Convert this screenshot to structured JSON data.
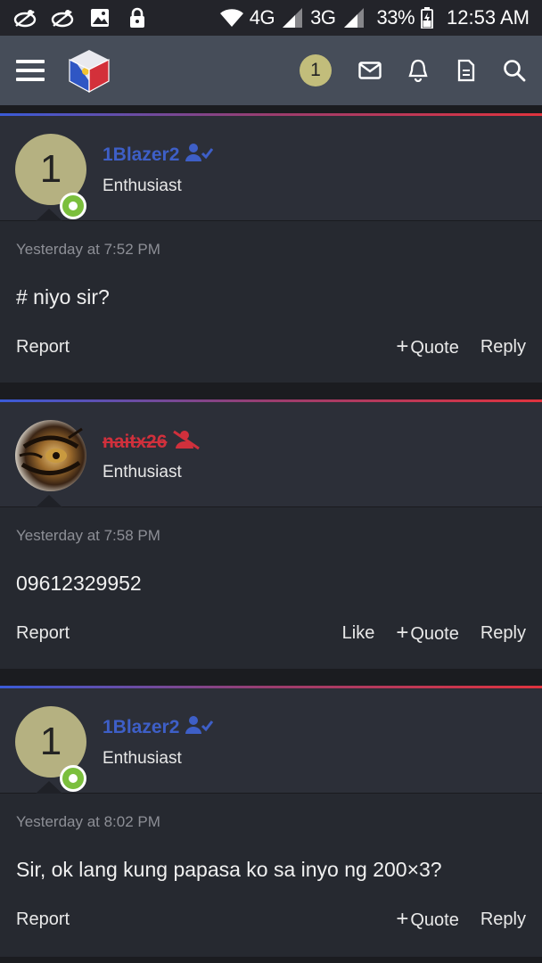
{
  "status_bar": {
    "network_4g": "4G",
    "network_3g": "3G",
    "battery": "33%",
    "time": "12:53 AM"
  },
  "header": {
    "badge_count": "1",
    "icons": [
      "menu-icon",
      "logo",
      "mail-icon",
      "bell-icon",
      "document-icon",
      "search-icon"
    ]
  },
  "posts": [
    {
      "avatar_initial": "1",
      "username": "1Blazer2",
      "user_title": "Enthusiast",
      "time": "Yesterday at 7:52 PM",
      "text": "# niyo sir?",
      "report": "Report",
      "quote": "Quote",
      "reply": "Reply"
    },
    {
      "avatar_initial": "",
      "username": "naitx26",
      "user_title": "Enthusiast",
      "time": "Yesterday at 7:58 PM",
      "text": "09612329952",
      "report": "Report",
      "like": "Like",
      "quote": "Quote",
      "reply": "Reply"
    },
    {
      "avatar_initial": "1",
      "username": "1Blazer2",
      "user_title": "Enthusiast",
      "time": "Yesterday at 8:02 PM",
      "text": "Sir, ok lang kung papasa ko sa inyo ng 200×3?",
      "report": "Report",
      "quote": "Quote",
      "reply": "Reply"
    }
  ],
  "colors": {
    "username": "#3e5fc7",
    "banned_username": "#d0303c",
    "online": "#7bbf3d",
    "header_bg": "#464d59"
  }
}
